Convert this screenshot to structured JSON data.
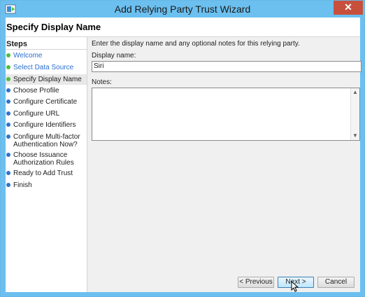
{
  "window": {
    "title": "Add Relying Party Trust Wizard",
    "close_glyph": "✕"
  },
  "page": {
    "title": "Specify Display Name"
  },
  "steps": {
    "heading": "Steps",
    "items": [
      {
        "label": "Welcome",
        "status": "done"
      },
      {
        "label": "Select Data Source",
        "status": "done"
      },
      {
        "label": "Specify Display Name",
        "status": "current"
      },
      {
        "label": "Choose Profile",
        "status": "pending"
      },
      {
        "label": "Configure Certificate",
        "status": "pending"
      },
      {
        "label": "Configure URL",
        "status": "pending"
      },
      {
        "label": "Configure Identifiers",
        "status": "pending"
      },
      {
        "label": "Configure Multi-factor Authentication Now?",
        "status": "pending"
      },
      {
        "label": "Choose Issuance Authorization Rules",
        "status": "pending"
      },
      {
        "label": "Ready to Add Trust",
        "status": "pending"
      },
      {
        "label": "Finish",
        "status": "pending"
      }
    ]
  },
  "form": {
    "instructions": "Enter the display name and any optional notes for this relying party.",
    "display_name_label": "Display name:",
    "display_name_value": "Siri",
    "notes_label": "Notes:",
    "notes_value": ""
  },
  "buttons": {
    "previous": "< Previous",
    "next": "Next >",
    "cancel": "Cancel"
  },
  "colors": {
    "titlebar": "#6cc0f0",
    "close": "#c7503d",
    "step_done": "#4fbf3f",
    "step_pending": "#2f74c8",
    "link": "#2a6fd0"
  }
}
